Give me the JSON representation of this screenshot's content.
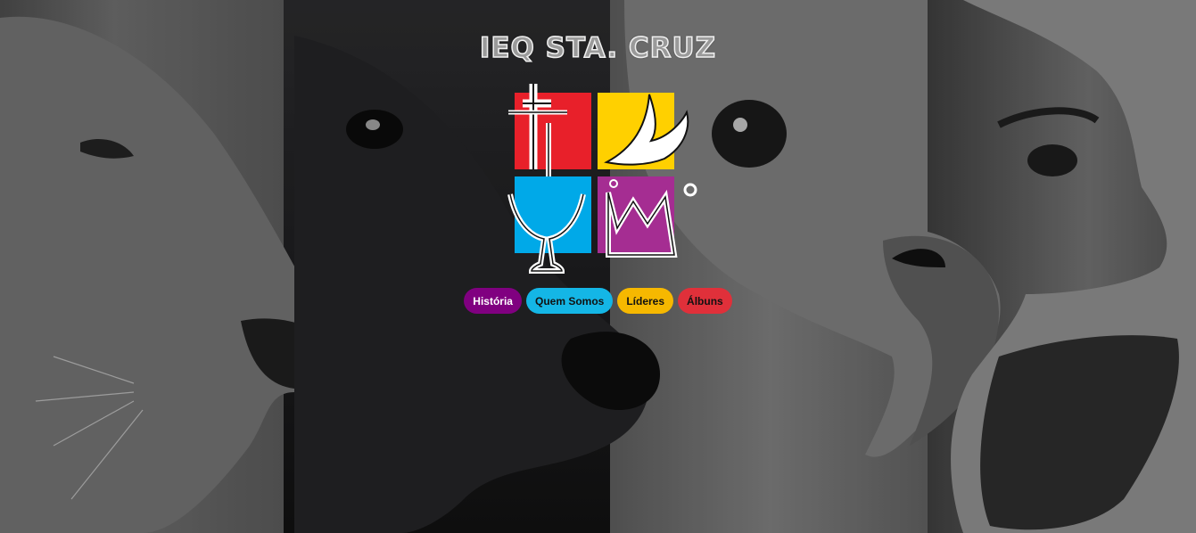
{
  "site": {
    "title": "IEQ STA. CRUZ"
  },
  "nav": {
    "items": [
      {
        "label": "História",
        "color": "#800080"
      },
      {
        "label": "Quem Somos",
        "color": "#14b6e6"
      },
      {
        "label": "Líderes",
        "color": "#f6b800"
      },
      {
        "label": "Álbuns",
        "color": "#e0303a"
      }
    ]
  },
  "logo": {
    "quadrant_colors": {
      "cross": "#e8202a",
      "dove": "#ffd000",
      "chalice": "#00a9e8",
      "crown": "#a52d92"
    }
  },
  "background": {
    "panels": [
      "lion",
      "ox",
      "eagle",
      "man"
    ]
  }
}
